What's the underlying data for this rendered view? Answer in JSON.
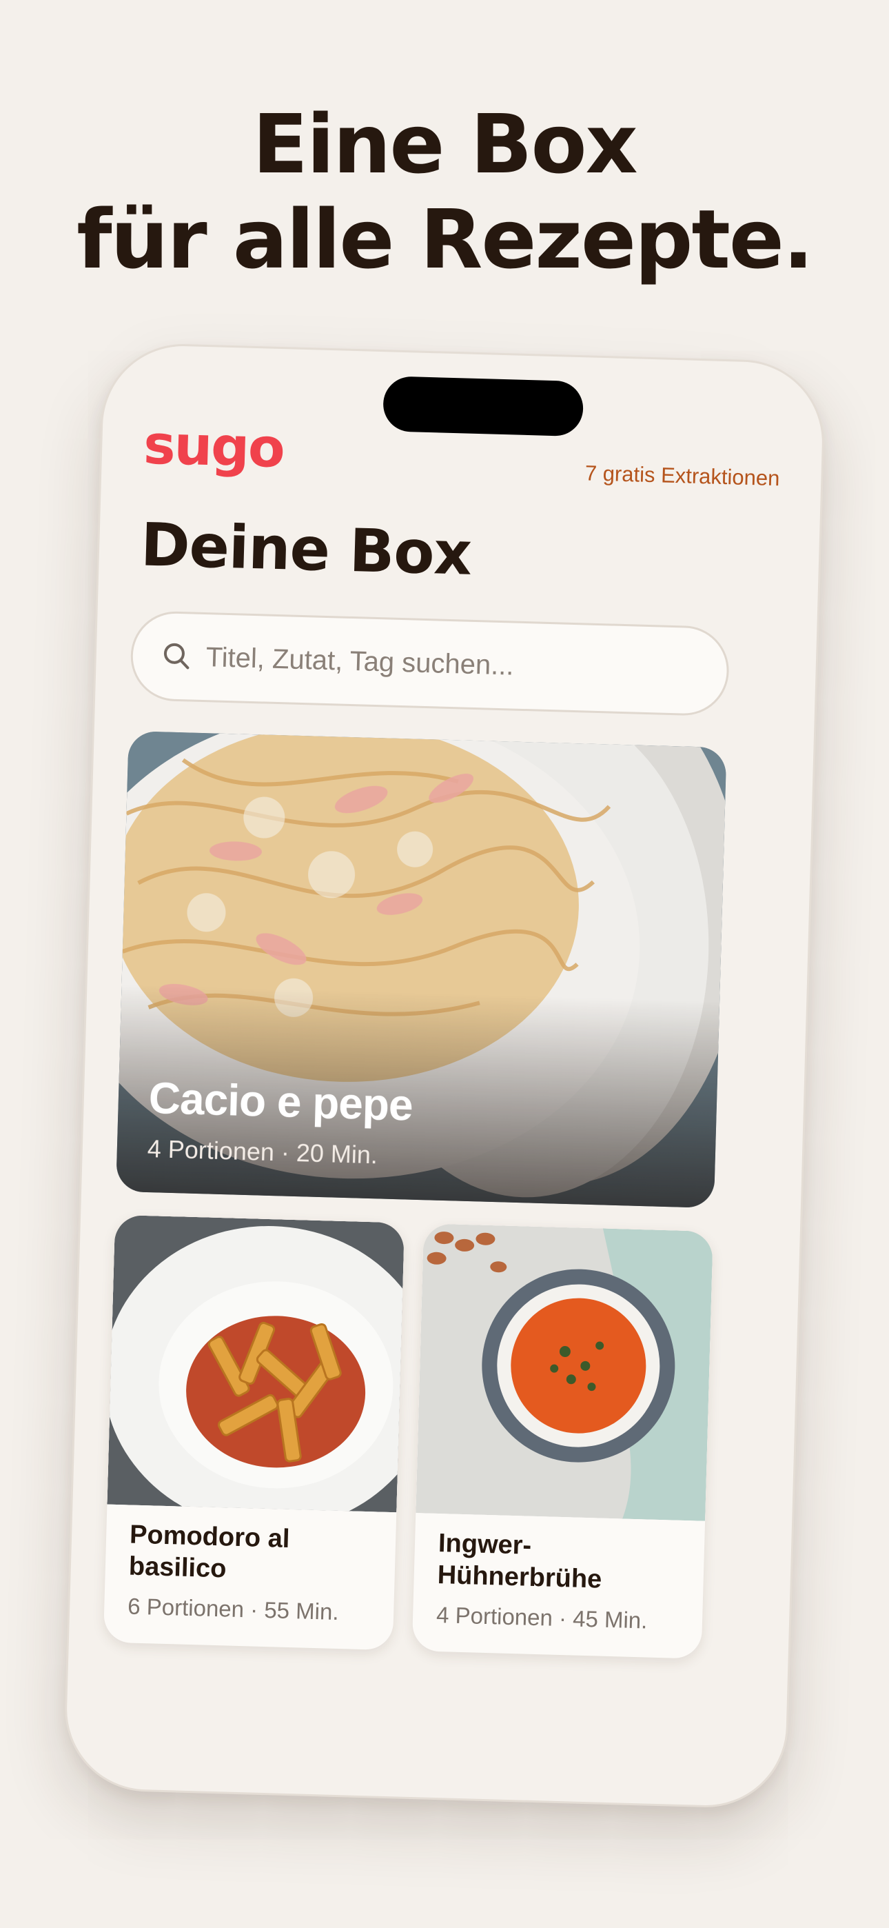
{
  "headline": {
    "line1": "Eine Box",
    "line2": "für alle Rezepte."
  },
  "app": {
    "logo": "sugo",
    "credits": "7 gratis Extraktionen",
    "title": "Deine Box"
  },
  "search": {
    "placeholder": "Titel, Zutat, Tag suchen...",
    "icon": "search-icon"
  },
  "recipes": [
    {
      "name": "Cacio e pepe",
      "meta": "4 Portionen · 20 Min."
    },
    {
      "name": "Pomodoro al basilico",
      "meta": "6 Portionen · 55 Min."
    },
    {
      "name": "Ingwer-Hühnerbrühe",
      "meta": "4 Portionen · 45 Min."
    }
  ],
  "colors": {
    "background": "#f4f0eb",
    "brand": "#f0424c",
    "accent": "#b5541c",
    "text": "#26180f"
  }
}
